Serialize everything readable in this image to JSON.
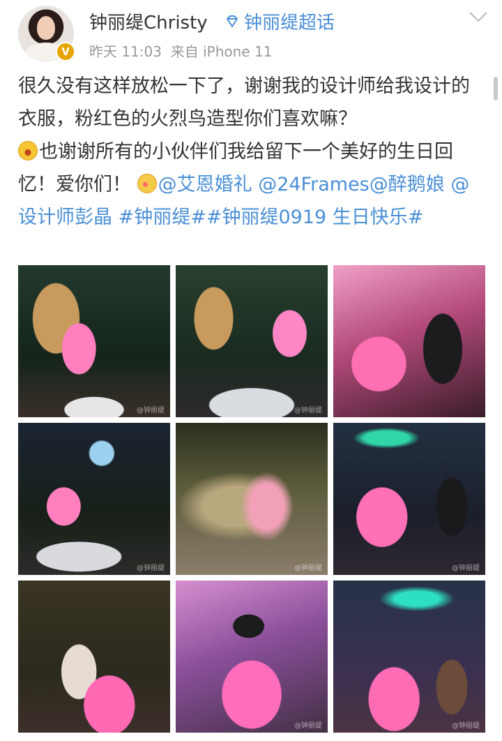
{
  "header": {
    "username": "钟丽缇Christy",
    "topic_label": "钟丽缇超话",
    "time": "昨天 11:03",
    "source": "来自 iPhone 11",
    "verified_badge": "V",
    "avatar_icon": "avatar-icon",
    "topic_icon": "diamond-topic-icon",
    "more_icon": "chevron-down-icon"
  },
  "post": {
    "text_1": "很久没有这样放松一下了，谢谢我的设计师给我设计的衣服，粉红色的火烈鸟造型你们喜欢嘛？",
    "text_2": "也谢谢所有的小伙伴们我给留下一个美好的生日回忆！爱你们！",
    "mention_1": "@艾恩婚礼",
    "mention_2": "@24Frames",
    "mention_3": "@醉鹅娘",
    "mention_4": "@设计师彭晶",
    "hashtag_1": "#钟丽缇#",
    "hashtag_2": "#钟丽缇0919 生日快乐#"
  },
  "photos": [
    {
      "watermark": "@钟丽缇"
    },
    {
      "watermark": "@钟丽缇"
    },
    {
      "watermark": ""
    },
    {
      "watermark": "@钟丽缇"
    },
    {
      "watermark": "@钟丽缇"
    },
    {
      "watermark": "@钟丽缇"
    },
    {
      "watermark": ""
    },
    {
      "watermark": "@钟丽缇"
    },
    {
      "watermark": "@钟丽缇"
    }
  ],
  "colors": {
    "link": "#4a8fd6",
    "text": "#333333",
    "meta": "#999999",
    "badge": "#e8a400"
  }
}
